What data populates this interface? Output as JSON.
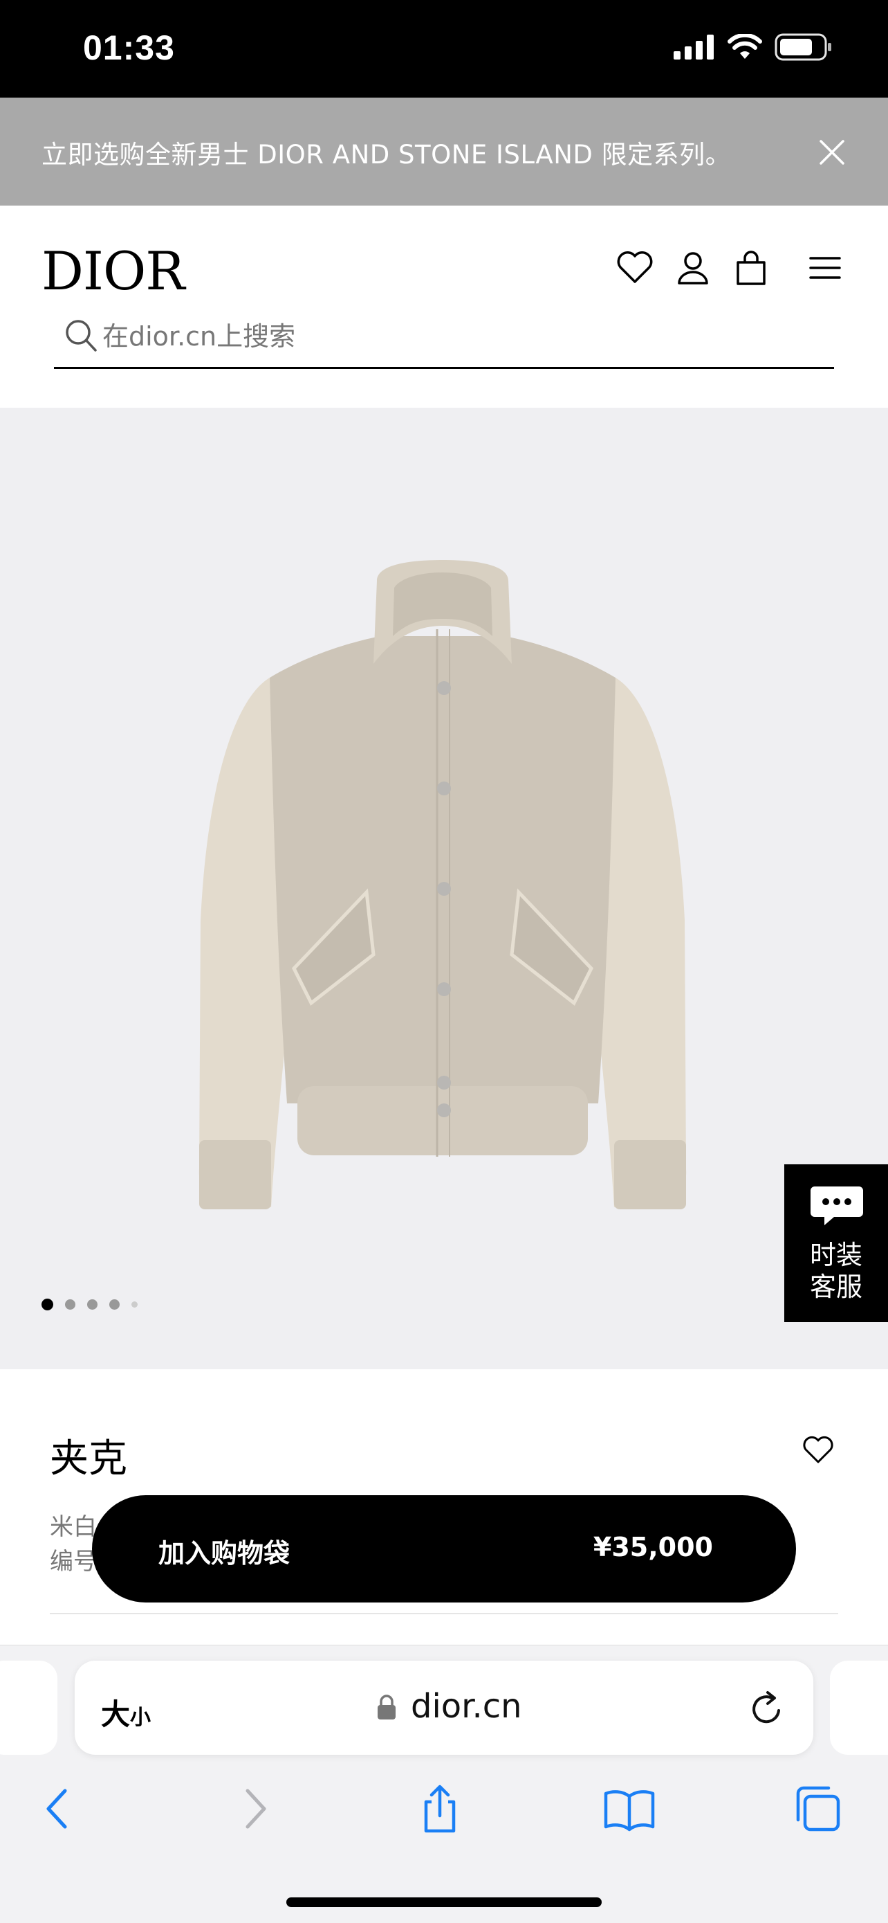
{
  "status_bar": {
    "time": "01:33",
    "icons": [
      "signal-icon",
      "wifi-icon",
      "battery-icon"
    ]
  },
  "promo_banner": {
    "text": "立即选购全新男士 DIOR AND STONE ISLAND 限定系列。",
    "close_icon": "close-icon"
  },
  "header": {
    "logo": "DIOR",
    "icons": [
      "heart-icon",
      "user-icon",
      "bag-icon",
      "menu-icon"
    ],
    "search": {
      "placeholder": "在dior.cn上搜索",
      "value": ""
    }
  },
  "hero": {
    "image": "jacket-image",
    "carousel": {
      "count": 5,
      "active_index": 0
    }
  },
  "chat_widget": {
    "label_line1": "时装",
    "label_line2": "客服"
  },
  "product": {
    "title": "夹克",
    "color_prefix": "米白",
    "sku_prefix": "编号"
  },
  "add_to_bag": {
    "label": "加入购物袋",
    "price": "¥35,000"
  },
  "browser": {
    "text_size_big": "大",
    "text_size_small": "小",
    "url": "dior.cn",
    "toolbar": [
      "back-icon",
      "forward-icon",
      "share-icon",
      "bookmarks-icon",
      "tabs-icon"
    ]
  },
  "colors": {
    "promo_bg": "#a9a9a9",
    "hero_bg": "#efeff2",
    "accent_blue": "#1a7ff5",
    "jacket_body": "#cdc5b8",
    "jacket_sleeve": "#e3dbcd"
  }
}
